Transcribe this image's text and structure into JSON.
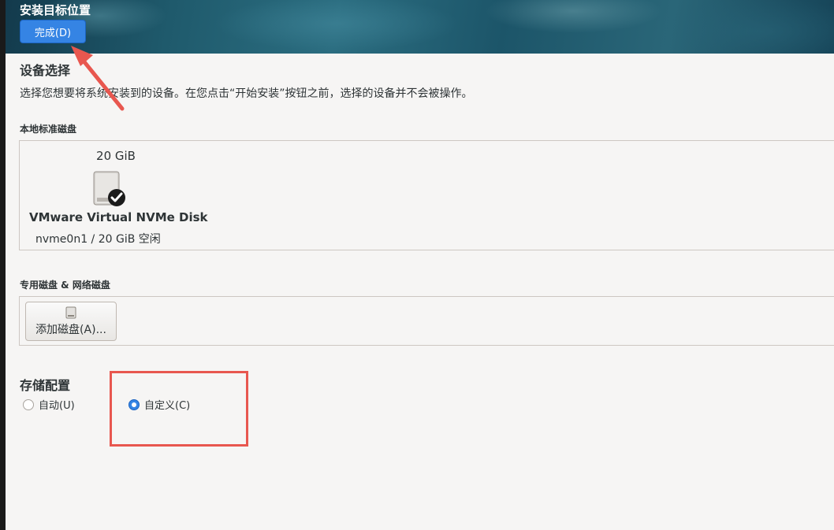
{
  "header": {
    "title": "安装目标位置",
    "done_label": "完成(D)"
  },
  "device_selection": {
    "title": "设备选择",
    "description": "选择您想要将系统安装到的设备。在您点击“开始安装”按钮之前，选择的设备并不会被操作。"
  },
  "local_disks": {
    "title": "本地标准磁盘",
    "disks": [
      {
        "size": "20 GiB",
        "name": "VMware Virtual NVMe Disk",
        "detail": "nvme0n1  /  20 GiB 空闲",
        "selected": true
      }
    ]
  },
  "special_disks": {
    "title": "专用磁盘 & 网络磁盘",
    "add_label": "添加磁盘(A)..."
  },
  "storage_config": {
    "title": "存储配置",
    "options": [
      {
        "label": "自动(U)",
        "checked": false
      },
      {
        "label": "自定义(C)",
        "checked": true
      }
    ]
  },
  "colors": {
    "accent": "#3584e4",
    "annotation": "#e8574f"
  }
}
